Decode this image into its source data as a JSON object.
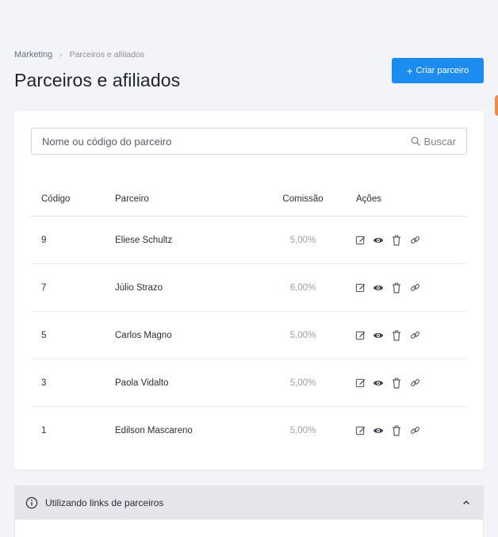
{
  "breadcrumb": {
    "root": "Marketing",
    "separator": "›",
    "current": "Parceiros e afiliados"
  },
  "page": {
    "title": "Parceiros e afiliados"
  },
  "create_button": {
    "plus": "+",
    "label": "Criar parceiro"
  },
  "search": {
    "placeholder": "Nome ou código do parceiro",
    "button_label": "Buscar"
  },
  "table": {
    "headers": {
      "code": "Código",
      "partner": "Parceiro",
      "commission": "Comissão",
      "actions": "Ações"
    },
    "rows": [
      {
        "code": "9",
        "partner": "Eliese Schultz",
        "commission": "5,00%"
      },
      {
        "code": "7",
        "partner": "Júlio Strazo",
        "commission": "6,00%"
      },
      {
        "code": "5",
        "partner": "Carlos Magno",
        "commission": "5,00%"
      },
      {
        "code": "3",
        "partner": "Paola Vidalto",
        "commission": "5,00%"
      },
      {
        "code": "1",
        "partner": "Edilson Mascareno",
        "commission": "5,00%"
      }
    ],
    "row_action_icons": [
      "edit-icon",
      "view-icon",
      "delete-icon",
      "link-icon"
    ]
  },
  "info_panel": {
    "title": "Utilizando links de parceiros",
    "icon": "info-icon",
    "toggle_icon": "chevron-up-icon"
  },
  "colors": {
    "primary": "#1d8cf0",
    "background": "#f3f4f7",
    "accent": "#f08a4b"
  }
}
